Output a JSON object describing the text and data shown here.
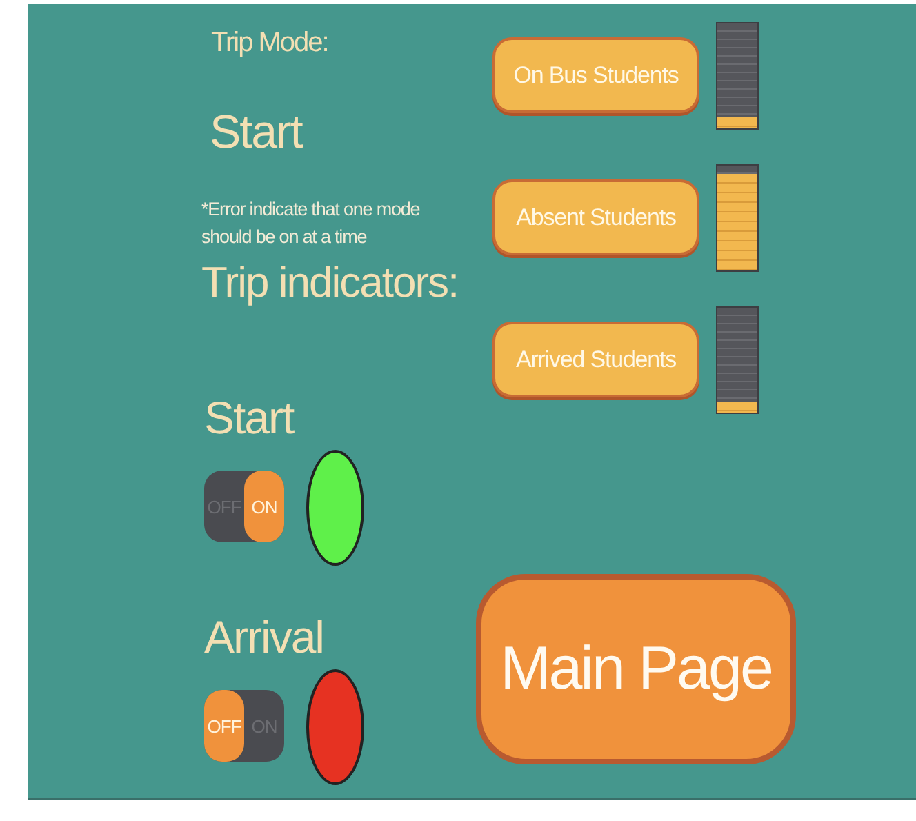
{
  "trip_mode": {
    "label": "Trip Mode:",
    "value": "Start",
    "note": "*Error indicate that one mode should be on at a time"
  },
  "mode_buttons": [
    {
      "label": "On Bus Students",
      "level": 0.1
    },
    {
      "label": "Absent Students",
      "level": 0.92
    },
    {
      "label": "Arrived Students",
      "level": 0.1
    }
  ],
  "indicators_title": "Trip indicators:",
  "indicators": [
    {
      "label": "Start",
      "off_label": "OFF",
      "on_label": "ON",
      "on": true,
      "color": "#5ff04a"
    },
    {
      "label": "Arrival",
      "off_label": "OFF",
      "on_label": "ON",
      "on": false,
      "color": "#e63222"
    }
  ],
  "main_button": "Main Page"
}
